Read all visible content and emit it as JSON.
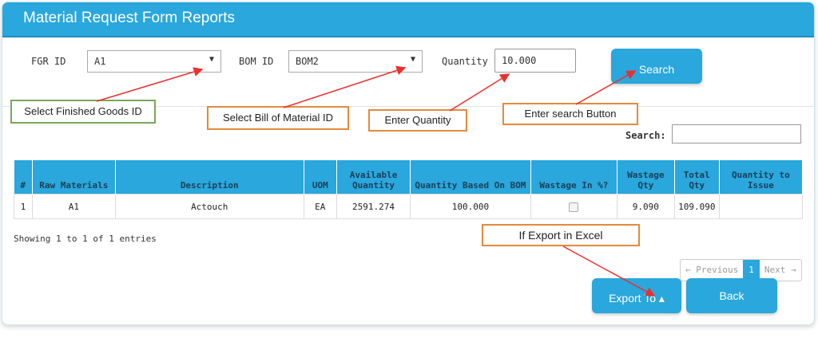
{
  "panel": {
    "title": "Material Request Form Reports"
  },
  "filters": {
    "fgr_label": "FGR ID",
    "fgr_value": "A1",
    "bom_label": "BOM ID",
    "bom_value": "BOM2",
    "qty_label": "Quantity",
    "qty_value": "10.000",
    "search_button": "Search"
  },
  "callouts": {
    "fgr": "Select Finished Goods ID",
    "bom": "Select Bill of Material ID",
    "qty": "Enter Quantity",
    "search": "Enter search Button",
    "export": "If Export in Excel"
  },
  "table_search": {
    "label": "Search:"
  },
  "table": {
    "headers": [
      "#",
      "Raw Materials",
      "Description",
      "UOM",
      "Available Quantity",
      "Quantity Based On BOM",
      "Wastage In %?",
      "Wastage Qty",
      "Total Qty",
      "Quantity to Issue"
    ],
    "rows": [
      [
        "1",
        "A1",
        "Actouch",
        "EA",
        "2591.274",
        "100.000",
        "",
        "9.090",
        "109.090",
        ""
      ]
    ]
  },
  "info": "Showing 1 to 1 of 1 entries",
  "pagination": {
    "previous": "← Previous",
    "current": "1",
    "next": "Next →"
  },
  "actions": {
    "export": "Export To ▴",
    "back": "Back"
  },
  "colors": {
    "header": "#2aa7dc",
    "callout_green": "#7aa85a",
    "callout_orange": "#e48a3a",
    "arrow": "#e8312f"
  }
}
